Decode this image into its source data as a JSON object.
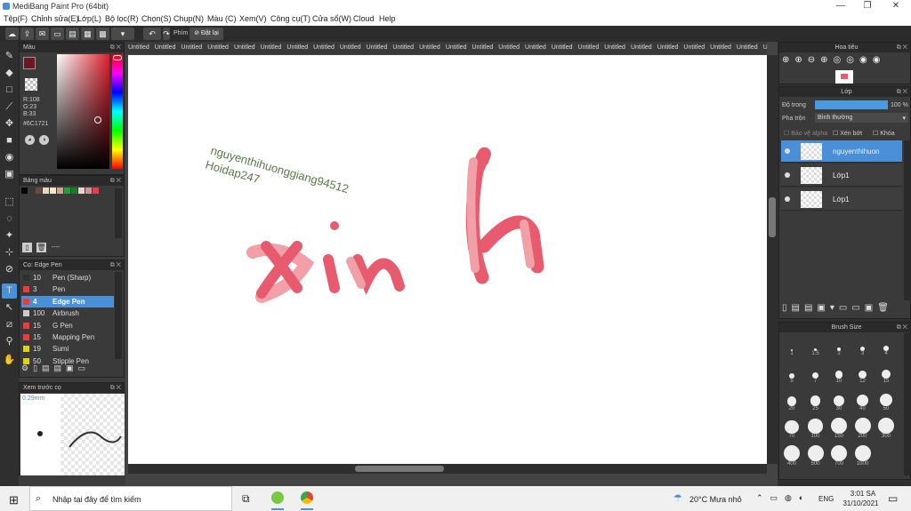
{
  "window": {
    "title": "MediBang Paint Pro (64bit)"
  },
  "menu": [
    "Tệp(F)",
    "Chỉnh sửa(E)",
    "Lớp(L)",
    "Bộ lọc(R)",
    "Chọn(S)",
    "Chụp(N)",
    "Màu (C)",
    "Xem(V)",
    "Công cụ(T)",
    "Cửa sổ(W)",
    "Cloud",
    "Help"
  ],
  "toolbar": {
    "key_label": "Phím",
    "reset_label": "Đặt lại"
  },
  "color_panel": {
    "title": "Màu",
    "r": "R:108",
    "g": "G:23",
    "b": "B:33",
    "hex": "#6C1721",
    "fg": "#6C1721",
    "bg": "#ffffff"
  },
  "swatch_panel": {
    "title": "Bảng màu",
    "swatches": [
      "#000000",
      "#3a3a3a",
      "#6b4c3c",
      "#e8d8c8",
      "#f5e6d3",
      "#c8a890",
      "#2a9a3a",
      "#1a7a2a",
      "#f0d0d0",
      "#c89898",
      "#e04050"
    ],
    "dash": "----"
  },
  "brush_panel": {
    "title": "Cọ: Edge Pen",
    "brushes": [
      {
        "size": "10",
        "name": "Pen (Sharp)",
        "color": "#303030"
      },
      {
        "size": "3",
        "name": "Pen",
        "color": "#e04040"
      },
      {
        "size": "4",
        "name": "Edge Pen",
        "color": "#e04040"
      },
      {
        "size": "100",
        "name": "Airbrush",
        "color": "#cccccc"
      },
      {
        "size": "15",
        "name": "G Pen",
        "color": "#e04040"
      },
      {
        "size": "15",
        "name": "Mapping Pen",
        "color": "#e04040"
      },
      {
        "size": "19",
        "name": "Sumi",
        "color": "#e0d020"
      },
      {
        "size": "50",
        "name": "Stipple Pen",
        "color": "#e0d020"
      }
    ]
  },
  "preview_panel": {
    "title": "Xem trước cọ",
    "size": "0.29mm"
  },
  "tabs": [
    "Untitled",
    "Untitled",
    "Untitled",
    "Untitled",
    "Untitled",
    "Untitled",
    "Untitled",
    "Untitled",
    "Untitled",
    "Untitled",
    "Untitled",
    "Untitled",
    "Untitled",
    "Untitled",
    "Untitled",
    "Untitled",
    "Untitled",
    "Untitled",
    "Untitled",
    "Untitled",
    "Untitled",
    "Untitled",
    "Untitled",
    "Untitled",
    "Untitled",
    "Untitled",
    "Untitled"
  ],
  "canvas": {
    "text1": "nguyenthihuonggiang94512",
    "text2": "Hoidap247",
    "drawing": "xinh"
  },
  "navigator": {
    "title": "Hoa tiêu"
  },
  "layer_panel": {
    "title": "Lớp",
    "opacity_label": "Độ trong",
    "opacity_value": "100 %",
    "opacity_fraction": 1.0,
    "blend_label": "Pha trộn",
    "blend_value": "Bình thường",
    "protect_alpha": "Bảo vệ alpha",
    "clip": "Xén bớt",
    "lock": "Khóa",
    "layers": [
      {
        "name": "nguyenthihuon",
        "selected": true
      },
      {
        "name": "Lớp1",
        "selected": false
      },
      {
        "name": "Lớp1",
        "selected": false
      }
    ]
  },
  "brush_size": {
    "title": "Brush Size",
    "sizes": [
      "1",
      "1.5",
      "2",
      "3",
      "4",
      "5",
      "7",
      "10",
      "12",
      "15",
      "20",
      "25",
      "30",
      "40",
      "50",
      "70",
      "100",
      "150",
      "200",
      "300",
      "400",
      "500",
      "700",
      "1000"
    ]
  },
  "taskbar": {
    "search_placeholder": "Nhập tại đây để tìm kiếm",
    "weather": "20°C  Mưa nhỏ",
    "lang": "ENG",
    "time": "3:01 SA",
    "date": "31/10/2021"
  }
}
